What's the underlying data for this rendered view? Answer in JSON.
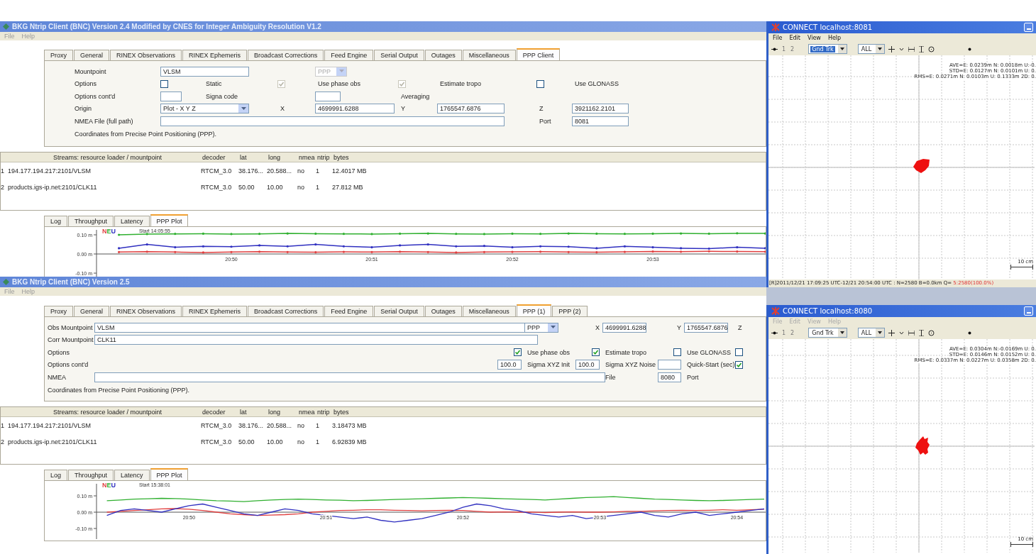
{
  "windows": [
    {
      "title": "BKG Ntrip Client (BNC) Version 2.4 Modified by CNES for Integer Ambiguity Resolution V1.2",
      "menu": [
        "File",
        "Help"
      ],
      "tabs": [
        {
          "label": "Proxy",
          "selected": false
        },
        {
          "label": "General",
          "selected": false
        },
        {
          "label": "RINEX Observations",
          "selected": false
        },
        {
          "label": "RINEX Ephemeris",
          "selected": false
        },
        {
          "label": "Broadcast Corrections",
          "selected": false
        },
        {
          "label": "Feed Engine",
          "selected": false
        },
        {
          "label": "Serial Output",
          "selected": false
        },
        {
          "label": "Outages",
          "selected": false
        },
        {
          "label": "Miscellaneous",
          "selected": false
        },
        {
          "label": "PPP Client",
          "selected": true
        }
      ],
      "form": [
        [
          {
            "kind": "label",
            "text": "Mountpoint"
          },
          {
            "kind": "field",
            "value": "VLSM"
          },
          {
            "kind": "select",
            "value": "PPP",
            "disabled": true
          }
        ],
        [
          {
            "kind": "label",
            "text": "Options"
          },
          {
            "kind": "checkbox",
            "checked": false,
            "disabled": false
          },
          {
            "kind": "label",
            "text": "Static"
          },
          {
            "kind": "checkbox",
            "checked": true,
            "disabled": true
          },
          {
            "kind": "label",
            "text": "Use phase obs"
          },
          {
            "kind": "checkbox",
            "checked": true,
            "disabled": true
          },
          {
            "kind": "label",
            "text": "Estimate tropo"
          },
          {
            "kind": "checkbox",
            "checked": false,
            "disabled": false
          },
          {
            "kind": "label",
            "text": "Use GLONASS"
          }
        ],
        [
          {
            "kind": "label",
            "text": "Options cont'd"
          },
          {
            "kind": "field"
          },
          {
            "kind": "label",
            "text": "Signa code"
          },
          {
            "kind": "field"
          },
          {
            "kind": "label",
            "text": "Averaging"
          }
        ],
        [
          {
            "kind": "label",
            "text": "Origin"
          },
          {
            "kind": "select",
            "value": "Plot - X Y Z",
            "disabled": false
          },
          {
            "kind": "label",
            "text": "X"
          },
          {
            "kind": "field",
            "value": "4699991.6288"
          },
          {
            "kind": "label",
            "text": "Y"
          },
          {
            "kind": "field",
            "value": "1765547.6876"
          },
          {
            "kind": "label",
            "text": "Z"
          },
          {
            "kind": "field",
            "value": "3921162.2101"
          }
        ],
        [
          {
            "kind": "label",
            "text": "NMEA File (full path)"
          },
          {
            "kind": "field"
          },
          {
            "kind": "label",
            "text": "Port"
          },
          {
            "kind": "field",
            "value": "8081"
          }
        ]
      ],
      "note": "Coordinates from Precise Point Positioning (PPP).",
      "streams": {
        "columns": [
          "Streams:  resource loader / mountpoint",
          "decoder",
          "lat",
          "long",
          "nmea",
          "ntrip",
          "bytes"
        ],
        "rows": [
          {
            "number": "1",
            "cells": [
              "194.177.194.217:2101/VLSM",
              "RTCM_3.0",
              "38.176...",
              "20.588...",
              "no",
              "1",
              "12.4017 MB"
            ]
          },
          {
            "number": "2",
            "cells": [
              "products.igs-ip.net:2101/CLK11",
              "RTCM_3.0",
              "50.00",
              "10.00",
              "no",
              "1",
              "27.812 MB"
            ]
          }
        ]
      },
      "log_tabs": [
        {
          "label": "Log",
          "selected": false
        },
        {
          "label": "Throughput",
          "selected": false
        },
        {
          "label": "Latency",
          "selected": false
        },
        {
          "label": "PPP Plot",
          "selected": true
        }
      ],
      "plot": {
        "kind": "sparse",
        "start": "Start 14:05:55",
        "chart_data": {
          "type": "line",
          "ylim": [
            -0.122,
            0.126
          ],
          "categories": [
            null,
            null,
            null,
            null,
            "20:50",
            null,
            null,
            null,
            null,
            "20:51",
            null,
            null,
            null,
            null,
            "20:52",
            null,
            null,
            null,
            null,
            "20:53",
            null,
            null,
            null,
            null
          ],
          "yticks": [
            {
              "value": 0.1,
              "label": "0.10 m"
            },
            {
              "value": 0,
              "label": "0.00 m"
            },
            {
              "value": -0.1,
              "label": "-0.10 m"
            }
          ],
          "series": [
            {
              "name": "N",
              "color": "#e04040",
              "values": [
                0.01,
                0.012,
                0.01,
                0.008,
                0.01,
                0.012,
                0.01,
                0.009,
                0.011,
                0.01,
                0.012,
                0.01,
                0.008,
                0.01,
                0.011,
                0.012,
                0.01,
                0.009,
                0.011,
                0.013,
                0.012,
                0.014,
                0.013,
                0.012
              ]
            },
            {
              "name": "E",
              "color": "#30b030",
              "values": [
                0.1,
                0.104,
                0.105,
                0.106,
                0.104,
                0.105,
                0.107,
                0.106,
                0.105,
                0.104,
                0.106,
                0.107,
                0.105,
                0.104,
                0.106,
                0.105,
                0.107,
                0.106,
                0.105,
                0.106,
                0.107,
                0.106,
                0.108,
                0.107
              ]
            },
            {
              "name": "U",
              "color": "#3030c0",
              "values": [
                0.03,
                0.05,
                0.035,
                0.04,
                0.038,
                0.045,
                0.04,
                0.05,
                0.04,
                0.035,
                0.045,
                0.05,
                0.04,
                0.042,
                0.035,
                0.04,
                0.038,
                0.03,
                0.04,
                0.035,
                0.03,
                0.028,
                0.035,
                0.03
              ]
            }
          ]
        }
      }
    },
    {
      "title": "BKG Ntrip Client (BNC) Version 2.5",
      "menu": [
        "File",
        "Help"
      ],
      "tabs": [
        {
          "label": "Proxy",
          "selected": false
        },
        {
          "label": "General",
          "selected": false
        },
        {
          "label": "RINEX Observations",
          "selected": false
        },
        {
          "label": "RINEX Ephemeris",
          "selected": false
        },
        {
          "label": "Broadcast Corrections",
          "selected": false
        },
        {
          "label": "Feed Engine",
          "selected": false
        },
        {
          "label": "Serial Output",
          "selected": false
        },
        {
          "label": "Outages",
          "selected": false
        },
        {
          "label": "Miscellaneous",
          "selected": false
        },
        {
          "label": "PPP (1)",
          "selected": true
        },
        {
          "label": "PPP (2)",
          "selected": false
        }
      ],
      "form": [
        [
          {
            "kind": "label",
            "text": "Obs Mountpoint"
          },
          {
            "kind": "field",
            "value": "VLSM"
          },
          {
            "kind": "select",
            "value": "PPP",
            "disabled": false
          },
          {
            "kind": "label",
            "text": "X"
          },
          {
            "kind": "field",
            "value": "4699991.6288"
          },
          {
            "kind": "label",
            "text": "Y"
          },
          {
            "kind": "field",
            "value": "1765547.6876"
          },
          {
            "kind": "label",
            "text": "Z"
          }
        ],
        [
          {
            "kind": "label",
            "text": "Corr Mountpoint"
          },
          {
            "kind": "field",
            "value": "CLK11"
          }
        ],
        [
          {
            "kind": "label",
            "text": "Options"
          },
          {
            "kind": "checkbox",
            "checked": true,
            "disabled": false
          },
          {
            "kind": "label",
            "text": "Use phase obs"
          },
          {
            "kind": "checkbox",
            "checked": true,
            "disabled": false
          },
          {
            "kind": "label",
            "text": "Estimate tropo"
          },
          {
            "kind": "checkbox",
            "checked": false,
            "disabled": false
          },
          {
            "kind": "label",
            "text": "Use GLONASS"
          },
          {
            "kind": "checkbox",
            "checked": false,
            "disabled": false
          }
        ],
        [
          {
            "kind": "label",
            "text": "Options cont'd"
          },
          {
            "kind": "field",
            "value": "100.0"
          },
          {
            "kind": "label",
            "text": "Sigma XYZ Init"
          },
          {
            "kind": "field",
            "value": "100.0"
          },
          {
            "kind": "label",
            "text": "Sigma XYZ Noise"
          },
          {
            "kind": "field"
          },
          {
            "kind": "label",
            "text": "Quick-Start (sec)"
          },
          {
            "kind": "checkbox",
            "checked": true,
            "disabled": false
          }
        ],
        [
          {
            "kind": "label",
            "text": "NMEA"
          },
          {
            "kind": "field"
          },
          {
            "kind": "label",
            "text": "File"
          },
          {
            "kind": "field",
            "value": "8080"
          },
          {
            "kind": "label",
            "text": "Port"
          }
        ]
      ],
      "note": "Coordinates from Precise Point Positioning (PPP).",
      "streams": {
        "columns": [
          "Streams:  resource loader / mountpoint",
          "decoder",
          "lat",
          "long",
          "nmea",
          "ntrip",
          "bytes"
        ],
        "rows": [
          {
            "number": "1",
            "cells": [
              "194.177.194.217:2101/VLSM",
              "RTCM_3.0",
              "38.176...",
              "20.588...",
              "no",
              "1",
              "3.18473 MB"
            ]
          },
          {
            "number": "2",
            "cells": [
              "products.igs-ip.net:2101/CLK11",
              "RTCM_3.0",
              "50.00",
              "10.00",
              "no",
              "1",
              "6.92839 MB"
            ]
          }
        ]
      },
      "log_tabs": [
        {
          "label": "Log",
          "selected": false
        },
        {
          "label": "Throughput",
          "selected": false
        },
        {
          "label": "Latency",
          "selected": false
        },
        {
          "label": "PPP Plot",
          "selected": true
        }
      ],
      "plot": {
        "kind": "dense",
        "start": "Start 15:38:01",
        "chart_data": {
          "type": "line",
          "ylim": [
            -0.165,
            0.174
          ],
          "categories": [
            null,
            null,
            null,
            null,
            null,
            null,
            "20:50",
            null,
            null,
            null,
            null,
            null,
            null,
            null,
            null,
            null,
            "20:51",
            null,
            null,
            null,
            null,
            null,
            null,
            null,
            null,
            null,
            "20:52",
            null,
            null,
            null,
            null,
            null,
            null,
            null,
            null,
            null,
            "20:53",
            null,
            null,
            null,
            null,
            null,
            null,
            null,
            null,
            null,
            "20:54",
            null,
            null
          ],
          "yticks": [
            {
              "value": 0.1,
              "label": "0.10 m"
            },
            {
              "value": 0,
              "label": "0.00 m"
            },
            {
              "value": -0.1,
              "label": "-0.10 m"
            }
          ],
          "series": [
            {
              "name": "N",
              "color": "#e04040",
              "values": [
                0,
                0.005,
                0.01,
                0.015,
                0.02,
                0.022,
                0.018,
                0.01,
                0,
                -0.01,
                -0.015,
                -0.02,
                -0.018,
                -0.015,
                -0.01,
                0,
                0.005,
                0.01,
                0.012,
                0.015,
                0.015,
                0.012,
                0.01,
                0.008,
                0.01,
                0.012,
                0.01,
                0.005,
                0,
                0.002,
                0,
                0,
                -0.002,
                0,
                0.002,
                0,
                0,
                0.002,
                0.005,
                0.005,
                0.008,
                0.01,
                0.012,
                0.01,
                0.012,
                0.015,
                0.012,
                0.015,
                0.018
              ]
            },
            {
              "name": "E",
              "color": "#30b030",
              "values": [
                0.07,
                0.075,
                0.08,
                0.082,
                0.085,
                0.083,
                0.08,
                0.075,
                0.07,
                0.068,
                0.065,
                0.07,
                0.075,
                0.078,
                0.08,
                0.078,
                0.075,
                0.073,
                0.07,
                0.072,
                0.075,
                0.078,
                0.08,
                0.082,
                0.085,
                0.087,
                0.09,
                0.088,
                0.085,
                0.082,
                0.08,
                0.078,
                0.075,
                0.08,
                0.085,
                0.09,
                0.092,
                0.095,
                0.09,
                0.085,
                0.08,
                0.078,
                0.075,
                0.072,
                0.07,
                0.072,
                0.075,
                0.078,
                0.08
              ]
            },
            {
              "name": "U",
              "color": "#3030c0",
              "values": [
                -0.02,
                0.01,
                0.02,
                0.01,
                0,
                0.02,
                0.04,
                0.05,
                0.03,
                0.01,
                -0.01,
                -0.02,
                0,
                0.02,
                0.01,
                -0.01,
                -0.02,
                -0.03,
                -0.04,
                -0.03,
                -0.05,
                -0.06,
                -0.05,
                -0.04,
                -0.02,
                0,
                0.03,
                0.05,
                0.04,
                0.02,
                0.01,
                -0.01,
                -0.02,
                -0.03,
                -0.02,
                -0.04,
                -0.03,
                -0.02,
                -0.01,
                0,
                -0.02,
                -0.03,
                -0.01,
                0,
                -0.02,
                -0.01,
                0,
                0.01,
                0.02
              ]
            }
          ]
        }
      }
    }
  ],
  "connect_windows": [
    {
      "title": "CONNECT localhost:8081",
      "menu": {
        "disabled": false,
        "items": [
          "File",
          "Edit",
          "View",
          "Help"
        ]
      },
      "toolbar": {
        "keys": [
          "1",
          "2"
        ],
        "mode": {
          "value": "Gnd Trk",
          "highlighted": true
        },
        "filter": "ALL"
      },
      "stats": [
        "AVE=E: 0.0239m N: 0.0018m U:-0.",
        "STD=E: 0.0127m N: 0.0101m U: 0.",
        "RMS=E: 0.0271m N: 0.0103m U: 0.1333m 2D: 0."
      ],
      "scale": "10 cm",
      "status": {
        "text": "[R]2011/12/21 17:09:25 UTC-12/21 20:54:00 UTC : N=2580 B=0.0km Q= ",
        "quality": "5:2580(100.0%)"
      }
    },
    {
      "title": "CONNECT localhost:8080",
      "menu": {
        "disabled": true,
        "items": [
          "File",
          "Edit",
          "View",
          "Help"
        ]
      },
      "toolbar": {
        "keys": [
          "1",
          "2"
        ],
        "mode": {
          "value": "Gnd Trk",
          "highlighted": false
        },
        "filter": "ALL"
      },
      "stats": [
        "AVE=E: 0.0304m N:-0.0169m U: 0.",
        "STD=E: 0.0146m N: 0.0152m U: 0.",
        "RMS=E: 0.0337m N: 0.0227m U: 0.0358m 2D: 0."
      ],
      "scale": "10 cm"
    }
  ]
}
